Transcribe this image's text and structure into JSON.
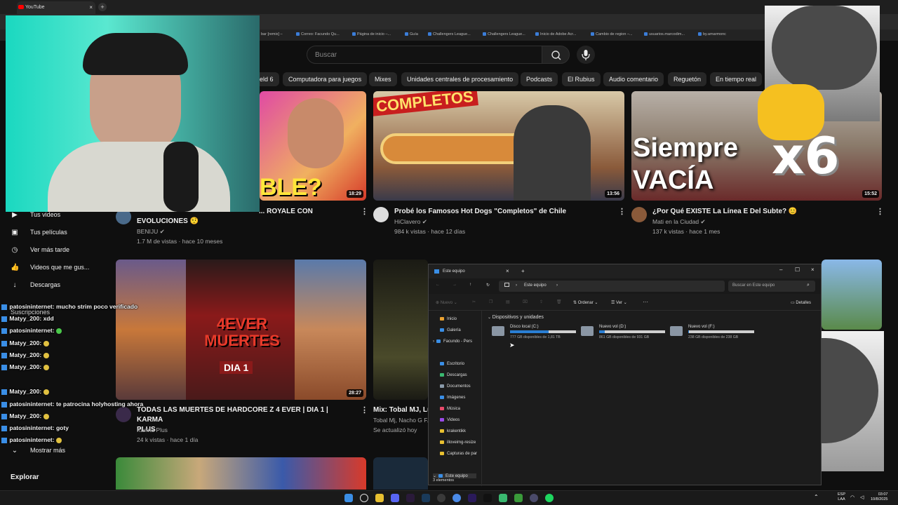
{
  "browser": {
    "tab_title": "YouTube",
    "bookmarks": [
      "bar [remix] –",
      "Correo: Facundo Qu...",
      "Página de inicio –...",
      "Guía",
      "Challengers League...",
      "Challengers League...",
      "Inicio de Adobe Acr...",
      "Cambio de region –...",
      "usuarios.marcodim...",
      "by.amarmonc"
    ]
  },
  "youtube": {
    "search_placeholder": "Buscar",
    "chips": [
      "eld 6",
      "Computadora para juegos",
      "Mixes",
      "Unidades centrales de procesamiento",
      "Podcasts",
      "El Rubius",
      "Audio comentario",
      "Reguetón",
      "En tiempo real"
    ],
    "sidebar": {
      "items": [
        {
          "icon": "▶",
          "label": "Tus videos"
        },
        {
          "icon": "▣",
          "label": "Tus películas"
        },
        {
          "icon": "◷",
          "label": "Ver más tarde"
        },
        {
          "icon": "👍",
          "label": "Videos que me gus..."
        },
        {
          "icon": "↓",
          "label": "Descargas"
        }
      ],
      "subscriptions_label": "Suscripciones",
      "show_more": "Mostrar más",
      "explore": "Explorar"
    },
    "videos_row1": [
      {
        "title_line1": "... ROYALE CON",
        "title_line2": "EVOLUCIONES 🤨",
        "channel": "BENIJU",
        "meta": "1.7 M de vistas · hace 10 meses",
        "duration": "18:29",
        "thumb_text": "BLE?"
      },
      {
        "title_line1": "Probé los Famosos Hot Dogs \"Completos\" de Chile",
        "channel": "HiClavero",
        "meta": "984 k vistas · hace 12 días",
        "duration": "13:56",
        "thumb_text": "COMPLETOS"
      },
      {
        "title_line1": "¿Por Qué EXISTE La Línea E Del Subte? 😊",
        "channel": "Mati en la Ciudad",
        "meta": "137 k vistas · hace 1 mes",
        "duration": "15:52",
        "thumb_text_1": "Siempre",
        "thumb_text_2": "VACÍA"
      }
    ],
    "videos_row2": [
      {
        "title_line1": "TODAS LAS MUERTES DE HARDCORE Z 4 EVER | DIA 1 | KARMA",
        "title_line2": "PLUS",
        "channel": "Karma Plus",
        "meta": "24 k vistas · hace 1 día",
        "duration": "28:27",
        "thumb_text_1": "4EVER",
        "thumb_text_2": "MUERTES",
        "thumb_text_3": "DIA 1"
      },
      {
        "title_line1": "Mix: Tobal MJ, Lu...",
        "channel": "Tobal Mj, Nacho G F...",
        "meta": "Se actualizó hoy"
      }
    ]
  },
  "overlay": {
    "multiplier": "x6"
  },
  "chat": [
    {
      "user": "patosininternet",
      "msg": ": mucho strim poco verificado",
      "color": "#f1f1f1"
    },
    {
      "user": "Matyy_200",
      "msg": ": xdd",
      "color": "#f1f1f1"
    },
    {
      "user": "patosininternet",
      "msg": ":",
      "color": "#f1f1f1"
    },
    {
      "user": "Matyy_200",
      "msg": ":",
      "color": "#f1f1f1"
    },
    {
      "user": "Matyy_200",
      "msg": ":",
      "color": "#f1f1f1"
    },
    {
      "user": "Matyy_200",
      "msg": ":",
      "color": "#f1f1f1"
    },
    {
      "user": "Matyy_200",
      "msg": ":",
      "color": "#f1f1f1"
    },
    {
      "user": "patosininternet",
      "msg": ": te patrocina holyhosting ahora",
      "color": "#f1f1f1"
    },
    {
      "user": "Matyy_200",
      "msg": ":",
      "color": "#f1f1f1"
    },
    {
      "user": "patosininternet",
      "msg": ": goty",
      "color": "#f1f1f1"
    },
    {
      "user": "patosininternet",
      "msg": ":",
      "color": "#f1f1f1"
    }
  ],
  "explorer": {
    "title": "Este equipo",
    "breadcrumb": "Este equipo",
    "search_placeholder": "Buscar en Este equipo",
    "new_label": "Nuevo",
    "sort_label": "Ordenar",
    "view_label": "Ver",
    "details_label": "Detalles",
    "section": "Dispositivos y unidades",
    "sidebar": [
      "Inicio",
      "Galería",
      "Facundo - Pers",
      "Escritorio",
      "Descargas",
      "Documentos",
      "Imágenes",
      "Música",
      "Videos",
      "krakentikk",
      "illoveimg-resize",
      "Capturas de par",
      "Este equipo"
    ],
    "drives": [
      {
        "name": "Disco local (C:)",
        "free": "777 GB disponibles de 1,81 TB",
        "used_fraction": 0.58
      },
      {
        "name": "Nuevo vol (D:)",
        "free": "861 GB disponibles de 931 GB",
        "used_fraction": 0.08
      },
      {
        "name": "Nuevo vol (F:)",
        "free": "238 GB disponibles de 238 GB",
        "used_fraction": 0.01
      }
    ],
    "status": "3 elementos"
  },
  "taskbar": {
    "lang": "ESP",
    "lang2": "LAA",
    "time": "03:07",
    "date": "10/8/2025"
  }
}
